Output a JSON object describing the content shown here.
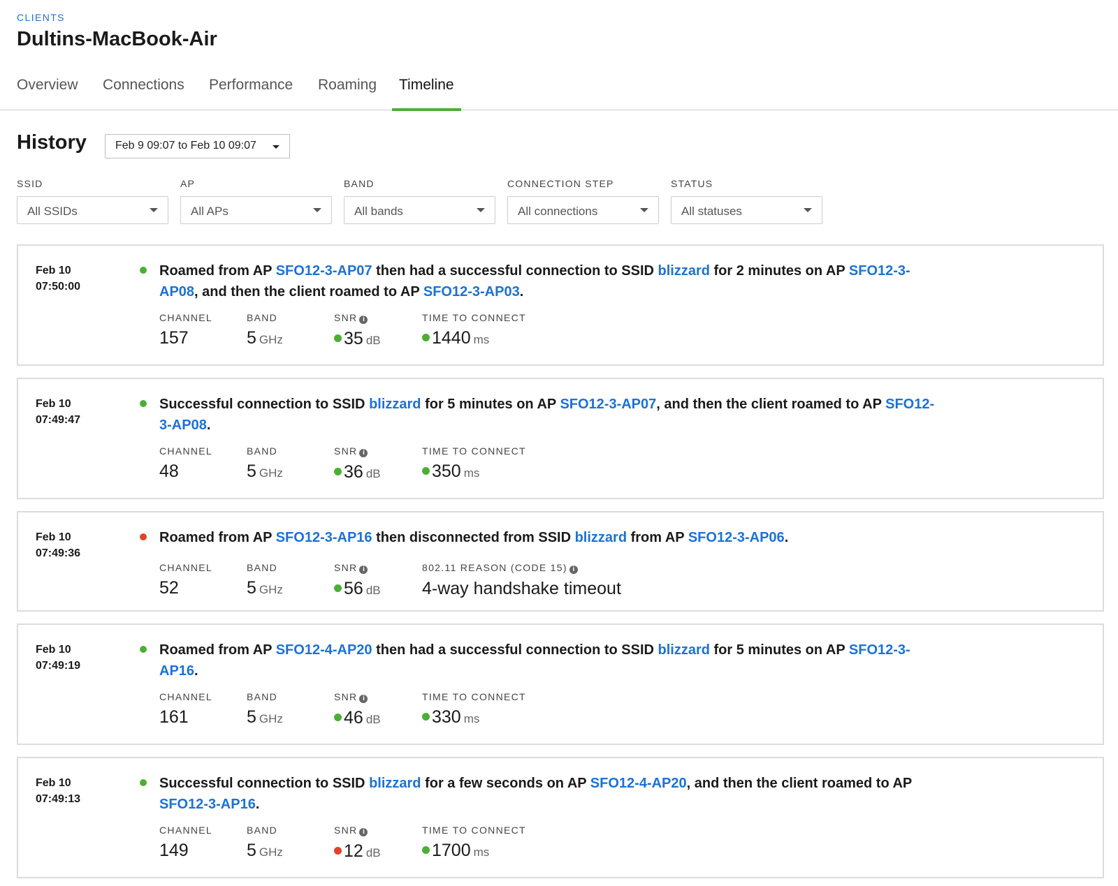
{
  "breadcrumb": "CLIENTS",
  "title": "Dultins-MacBook-Air",
  "tabs": [
    "Overview",
    "Connections",
    "Performance",
    "Roaming",
    "Timeline"
  ],
  "active_tab": "Timeline",
  "history": {
    "title": "History",
    "range": "Feb 9 09:07 to Feb 10 09:07"
  },
  "filters": [
    {
      "label": "SSID",
      "value": "All SSIDs"
    },
    {
      "label": "AP",
      "value": "All APs"
    },
    {
      "label": "BAND",
      "value": "All bands"
    },
    {
      "label": "CONNECTION STEP",
      "value": "All connections"
    },
    {
      "label": "STATUS",
      "value": "All statuses"
    }
  ],
  "colors": {
    "accent": "#4caf35",
    "link": "#1b72d6",
    "good": "#4caf35",
    "bad": "#e2432a"
  },
  "metric_labels": {
    "channel": "CHANNEL",
    "band": "BAND",
    "snr": "SNR",
    "ttc": "TIME TO CONNECT",
    "reason": "802.11 REASON (CODE 15)",
    "band_unit": "GHz",
    "snr_unit": "dB",
    "ttc_unit": "ms"
  },
  "events": [
    {
      "date": "Feb 10",
      "time": "07:50:00",
      "status": "good",
      "desc_parts": [
        {
          "t": "Roamed from AP "
        },
        {
          "t": "SFO12-3-AP07",
          "link": true
        },
        {
          "t": " then had a successful connection to SSID "
        },
        {
          "t": "blizzard",
          "link": true
        },
        {
          "t": " for 2 minutes on AP "
        },
        {
          "t": "SFO12-3-AP08",
          "link": true,
          "split": [
            "SFO12-3-",
            "AP08"
          ]
        },
        {
          "t": ", and then the client roamed to AP "
        },
        {
          "t": "SFO12-3-AP03",
          "link": true
        },
        {
          "t": "."
        }
      ],
      "channel": "157",
      "band": "5",
      "snr": "35",
      "snr_status": "good",
      "ttc": "1440",
      "ttc_status": "good"
    },
    {
      "date": "Feb 10",
      "time": "07:49:47",
      "status": "good",
      "desc_parts": [
        {
          "t": "Successful connection to SSID "
        },
        {
          "t": "blizzard",
          "link": true
        },
        {
          "t": " for 5 minutes on AP "
        },
        {
          "t": "SFO12-3-AP07",
          "link": true
        },
        {
          "t": ", and then the client roamed to AP "
        },
        {
          "t": "SFO12-3-AP08",
          "link": true,
          "split": [
            "SFO12-",
            "3-AP08"
          ]
        },
        {
          "t": "."
        }
      ],
      "channel": "48",
      "band": "5",
      "snr": "36",
      "snr_status": "good",
      "ttc": "350",
      "ttc_status": "good"
    },
    {
      "date": "Feb 10",
      "time": "07:49:36",
      "status": "bad",
      "desc_parts": [
        {
          "t": "Roamed from AP "
        },
        {
          "t": "SFO12-3-AP16",
          "link": true
        },
        {
          "t": " then disconnected from SSID "
        },
        {
          "t": "blizzard",
          "link": true
        },
        {
          "t": " from AP "
        },
        {
          "t": "SFO12-3-AP06",
          "link": true
        },
        {
          "t": "."
        }
      ],
      "channel": "52",
      "band": "5",
      "snr": "56",
      "snr_status": "good",
      "reason": "4-way handshake timeout"
    },
    {
      "date": "Feb 10",
      "time": "07:49:19",
      "status": "good",
      "desc_parts": [
        {
          "t": "Roamed from AP "
        },
        {
          "t": "SFO12-4-AP20",
          "link": true
        },
        {
          "t": " then had a successful connection to SSID "
        },
        {
          "t": "blizzard",
          "link": true
        },
        {
          "t": " for 5 minutes on AP "
        },
        {
          "t": "SFO12-3-AP16",
          "link": true,
          "split": [
            "SFO12-3-",
            "AP16"
          ]
        },
        {
          "t": "."
        }
      ],
      "channel": "161",
      "band": "5",
      "snr": "46",
      "snr_status": "good",
      "ttc": "330",
      "ttc_status": "good"
    },
    {
      "date": "Feb 10",
      "time": "07:49:13",
      "status": "good",
      "desc_parts": [
        {
          "t": "Successful connection to SSID "
        },
        {
          "t": "blizzard",
          "link": true
        },
        {
          "t": " for a few seconds on AP "
        },
        {
          "t": "SFO12-4-AP20",
          "link": true
        },
        {
          "t": ", and then the client roamed to AP",
          "br_after": true
        },
        {
          "t": "SFO12-3-AP16",
          "link": true
        },
        {
          "t": "."
        }
      ],
      "channel": "149",
      "band": "5",
      "snr": "12",
      "snr_status": "bad",
      "ttc": "1700",
      "ttc_status": "good"
    }
  ]
}
